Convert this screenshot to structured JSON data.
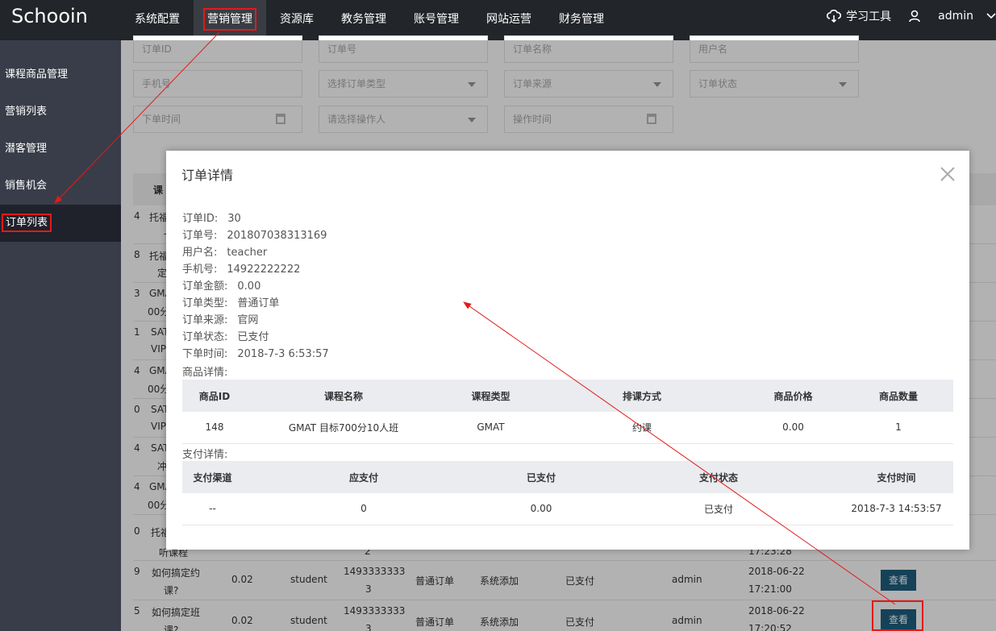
{
  "app": {
    "logo": "Schooin"
  },
  "nav": [
    {
      "label": "系统配置",
      "active": false
    },
    {
      "label": "营销管理",
      "active": true
    },
    {
      "label": "资源库",
      "active": false
    },
    {
      "label": "教务管理",
      "active": false
    },
    {
      "label": "账号管理",
      "active": false
    },
    {
      "label": "网站运营",
      "active": false
    },
    {
      "label": "财务管理",
      "active": false
    }
  ],
  "topRight": {
    "tools_label": "学习工具",
    "username": "admin",
    "tools_icon": "cloud-download-icon",
    "user_icon": "user-icon",
    "menu_icon": "chevron-down-icon"
  },
  "sidebar": {
    "items": [
      {
        "label": "课程商品管理"
      },
      {
        "label": "营销列表"
      },
      {
        "label": "潜客管理"
      },
      {
        "label": "销售机会"
      },
      {
        "label": "订单列表"
      }
    ]
  },
  "filters": {
    "order_id": "订单ID",
    "order_no": "订单号",
    "order_name": "订单名称",
    "username": "用户名",
    "phone": "手机号",
    "order_type": "选择订单类型",
    "order_source": "订单来源",
    "order_status": "订单状态",
    "order_time": "下单时间",
    "operator": "请选择操作人",
    "operate_time": "操作时间"
  },
  "table": {
    "header_first": "课",
    "rows_partial": [
      {
        "id": "4",
        "name1": "托福",
        "name2": "一单"
      },
      {
        "id": "8",
        "name1": "托福",
        "name2": "定"
      },
      {
        "id": "3",
        "name1": "GMA",
        "name2": "00分"
      },
      {
        "id": "1",
        "name1": "SAT",
        "name2": "VIP"
      },
      {
        "id": "4",
        "name1": "GMA",
        "name2": "00分"
      },
      {
        "id": "0",
        "name1": "SAT",
        "name2": "VIP"
      },
      {
        "id": "4",
        "name1": "SAT",
        "name2": "冲"
      },
      {
        "id": "4",
        "name1": "GMA",
        "name2": "00分"
      },
      {
        "id": "0",
        "name1": "托福",
        "name2": "听课程",
        "phone2": "2",
        "time2": "17:23:28"
      }
    ],
    "rows_full": [
      {
        "id": "9",
        "name1": "如何搞定约",
        "name2": "课?",
        "amount": "0.02",
        "user": "student",
        "phone1": "1493333333",
        "phone2": "3",
        "type": "普通订单",
        "source": "系统添加",
        "status": "已支付",
        "operator": "admin",
        "date": "2018-06-22",
        "time": "17:21:00",
        "action": "查看"
      },
      {
        "id": "5",
        "name1": "如何搞定班",
        "name2": "课?",
        "amount": "0.02",
        "user": "student",
        "phone1": "1493333333",
        "phone2": "3",
        "type": "普通订单",
        "source": "系统添加",
        "status": "已支付",
        "operator": "admin",
        "date": "2018-06-22",
        "time": "17:20:52",
        "action": "查看"
      }
    ]
  },
  "modal": {
    "title": "订单详情",
    "close_icon": "close-icon",
    "info": [
      {
        "k": "订单ID:",
        "v": "30"
      },
      {
        "k": "订单号:",
        "v": "201807038313169"
      },
      {
        "k": "用户名:",
        "v": "teacher"
      },
      {
        "k": "手机号:",
        "v": "14922222222"
      },
      {
        "k": "订单金额:",
        "v": "0.00"
      },
      {
        "k": "订单类型:",
        "v": "普通订单"
      },
      {
        "k": "订单来源:",
        "v": "官网"
      },
      {
        "k": "订单状态:",
        "v": "已支付"
      },
      {
        "k": "下单时间:",
        "v": "2018-7-3 6:53:57"
      }
    ],
    "goods_label": "商品详情:",
    "goods_headers": [
      "商品ID",
      "课程名称",
      "课程类型",
      "排课方式",
      "商品价格",
      "商品数量"
    ],
    "goods_rows": [
      [
        "148",
        "GMAT 目标700分10人班",
        "GMAT",
        "约课",
        "0.00",
        "1"
      ]
    ],
    "pay_label": "支付详情:",
    "pay_headers": [
      "支付渠道",
      "应支付",
      "已支付",
      "支付状态",
      "支付时间"
    ],
    "pay_rows": [
      [
        "--",
        "0",
        "0.00",
        "已支付",
        "2018-7-3 14:53:57"
      ]
    ]
  },
  "colors": {
    "topbar": "#222529",
    "sidebar": "#393d49",
    "annotation": "#e41919",
    "button": "#1f5f7f"
  }
}
